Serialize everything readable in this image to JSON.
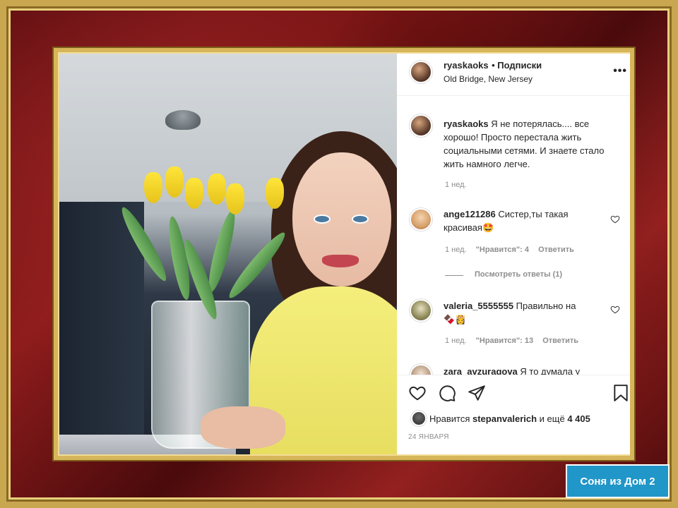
{
  "post": {
    "username": "ryaskaoks",
    "follow_label": "• Подписки",
    "location": "Old Bridge, New Jersey",
    "more_label": "•••",
    "caption_text": "Я не потерялась.... все хорошо! Просто перестала жить социальными сетями. И знаете стало жить намного легче.",
    "caption_time": "1 нед."
  },
  "comments": [
    {
      "user": "ange121286",
      "text": "Систер,ты такая красивая",
      "emoji": "🤩",
      "time": "1 нед.",
      "likes": "\"Нравится\": 4",
      "reply": "Ответить",
      "view_replies": "Посмотреть ответы (1)"
    },
    {
      "user": "valeria_5555555",
      "text": "Правильно на",
      "emoji": "🍫👸",
      "time": "1 нед.",
      "likes": "\"Нравится\": 13",
      "reply": "Ответить"
    },
    {
      "user": "zara_avzuragova",
      "text": "Я то думала у"
    }
  ],
  "footer": {
    "likes_prefix": "Нравится",
    "likes_user": "stepanvalerich",
    "likes_suffix": "и ещё",
    "likes_count": "4 405",
    "date": "24 ЯНВАРЯ"
  },
  "badge": {
    "label": "Соня из Дом 2",
    "color": "#2196c8"
  }
}
